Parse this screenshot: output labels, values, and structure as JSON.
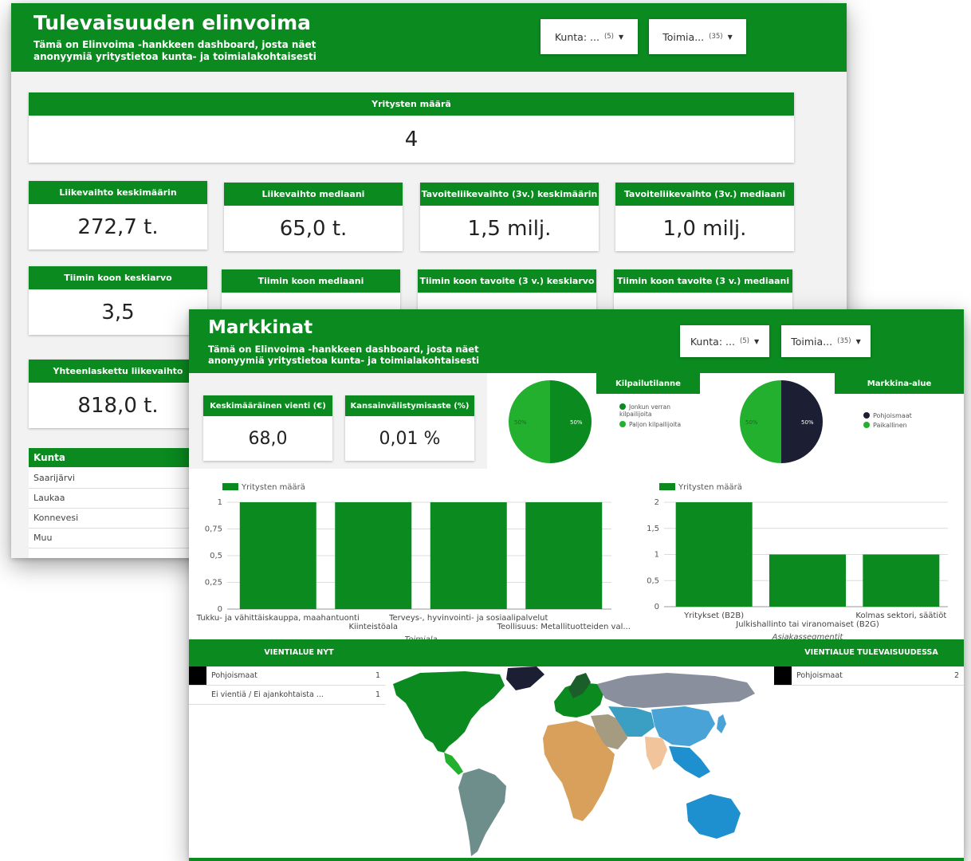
{
  "colors": {
    "brand_green": "#0a8a1f",
    "light_green": "#22b02e",
    "dark_navy": "#1c1f33",
    "panel_grey": "#f2f2f2"
  },
  "back": {
    "title": "Tulevaisuuden elinvoima",
    "subtitle_line1": "Tämä on Elinvoima -hankkeen dashboard, josta näet",
    "subtitle_line2": "anonyymiä yritystietoa kunta- ja toimialakohtaisesti",
    "filter_kunta": {
      "label": "Kunta: ...",
      "count": "(5)",
      "icon": "caret-down-icon"
    },
    "filter_toimiala": {
      "label": "Toimia...",
      "count": "(35)",
      "icon": "caret-down-icon"
    },
    "total": {
      "label": "Yritysten määrä",
      "value": "4"
    },
    "row1": [
      {
        "label": "Liikevaihto keskimäärin",
        "value": "272,7 t."
      },
      {
        "label": "Liikevaihto mediaani",
        "value": "65,0 t."
      },
      {
        "label": "Tavoiteliikevaihto (3v.) keskimäärin",
        "value": "1,5 milj."
      },
      {
        "label": "Tavoiteliikevaihto (3v.) mediaani",
        "value": "1,0 milj."
      }
    ],
    "row2": [
      {
        "label": "Tiimin koon keskiarvo",
        "value": "3,5"
      },
      {
        "label": "Tiimin koon mediaani",
        "value": ""
      },
      {
        "label": "Tiimin koon tavoite (3 v.) keskiarvo",
        "value": ""
      },
      {
        "label": "Tiimin koon tavoite (3 v.) mediaani",
        "value": ""
      }
    ],
    "sum": {
      "label": "Yhteenlaskettu liikevaihto",
      "value": "818,0 t."
    },
    "kunta_table": {
      "header": "Kunta",
      "rows": [
        "Saarijärvi",
        "Laukaa",
        "Konnevesi",
        "Muu"
      ]
    }
  },
  "front": {
    "title": "Markkinat",
    "subtitle_line1": "Tämä on Elinvoima -hankkeen dashboard, josta näet",
    "subtitle_line2": "anonyymiä yritystietoa kunta- ja toimialakohtaisesti",
    "filter_kunta": {
      "label": "Kunta: ...",
      "count": "(5)",
      "icon": "caret-down-icon"
    },
    "filter_toimiala": {
      "label": "Toimia...",
      "count": "(35)",
      "icon": "caret-down-icon"
    },
    "kpi_vienti": {
      "label": "Keskimääräinen vienti (€)",
      "value": "68,0"
    },
    "kpi_kansainv": {
      "label": "Kansainvälistymisaste (%)",
      "value": "0,01 %"
    },
    "kilpailu_tab": "Kilpailutilanne",
    "markkina_tab": "Markkina-alue",
    "vientialue_nyt": "VIENTIALUE NYT",
    "vientialue_tulevaisuus": "VIENTIALUE TULEVAISUUDESSA",
    "vienti_nyt_rows": [
      {
        "label": "Pohjoismaat",
        "count": "1"
      },
      {
        "label": "Ei vientiä / Ei ajankohtaista ...",
        "count": "1"
      }
    ],
    "vienti_tulevaisuus_rows": [
      {
        "label": "Pohjoismaat",
        "count": "2"
      }
    ],
    "map": {
      "continents": [
        "north-america",
        "south-america",
        "europe",
        "africa",
        "asia",
        "oceania",
        "greenland"
      ]
    }
  },
  "chart_data": [
    {
      "type": "pie",
      "title": "Kilpailutilanne",
      "slices": [
        {
          "label": "Jonkun verran kilpailijoita",
          "value": 50,
          "color": "#0a8a1f"
        },
        {
          "label": "Paljon kilpailijoita",
          "value": 50,
          "color": "#22b02e"
        }
      ],
      "slice_labels": [
        "50%",
        "50%"
      ]
    },
    {
      "type": "pie",
      "title": "Markkina-alue",
      "slices": [
        {
          "label": "Pohjoismaat",
          "value": 50,
          "color": "#1c1f33"
        },
        {
          "label": "Paikallinen",
          "value": 50,
          "color": "#22b02e"
        }
      ],
      "slice_labels": [
        "50%",
        "50%"
      ]
    },
    {
      "type": "bar",
      "legend": "Yritysten määrä",
      "xlabel": "Toimiala",
      "categories": [
        "Tukku- ja vähittäiskauppa, maahantuonti",
        "Kiinteistöala",
        "Terveys-, hyvinvointi- ja sosiaalipalvelut",
        "Teollisuus: Metallituotteiden val..."
      ],
      "values": [
        1,
        1,
        1,
        1
      ],
      "ylim": [
        0,
        1
      ],
      "yticks": [
        "0",
        "0,25",
        "0,5",
        "0,75",
        "1"
      ],
      "ytick_values": [
        0,
        0.25,
        0.5,
        0.75,
        1
      ]
    },
    {
      "type": "bar",
      "legend": "Yritysten määrä",
      "xlabel": "Asiakassegmentit",
      "categories": [
        "Yritykset (B2B)",
        "Julkishallinto tai viranomaiset (B2G)",
        "Kolmas sektori, säätiöt"
      ],
      "values": [
        2,
        1,
        1
      ],
      "ylim": [
        0,
        2
      ],
      "yticks": [
        "0",
        "0,5",
        "1",
        "1,5",
        "2"
      ],
      "ytick_values": [
        0,
        0.5,
        1,
        1.5,
        2
      ]
    }
  ]
}
